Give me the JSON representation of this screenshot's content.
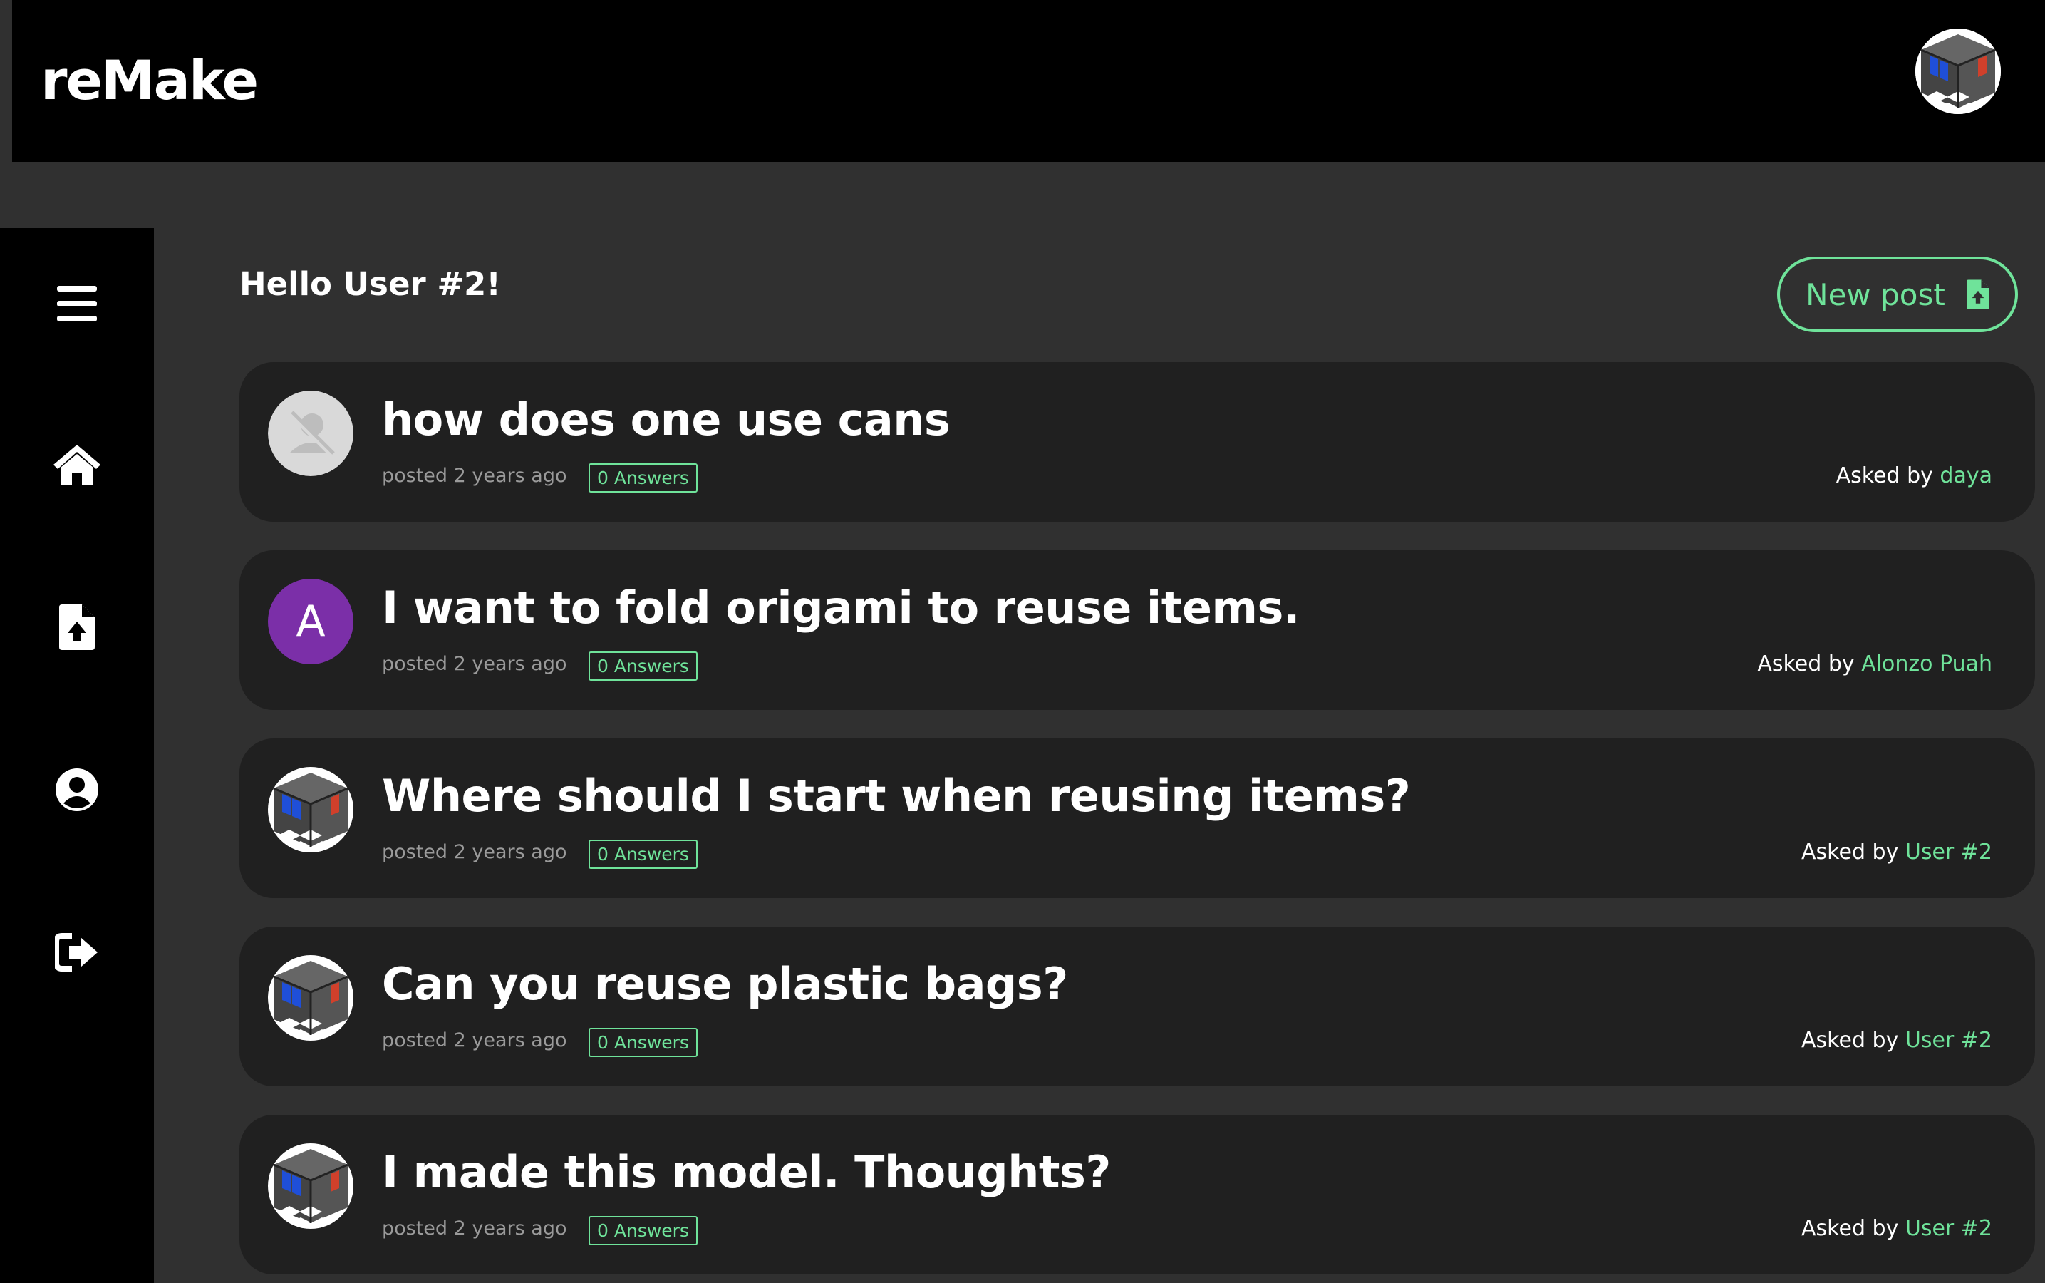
{
  "app": {
    "logo": "reMake"
  },
  "header": {
    "avatar_icon": "rubiks-cube-avatar"
  },
  "sidebar": {
    "items": [
      {
        "name": "menu",
        "icon": "hamburger-menu-icon"
      },
      {
        "name": "home",
        "icon": "home-icon"
      },
      {
        "name": "new-post",
        "icon": "file-upload-icon"
      },
      {
        "name": "profile",
        "icon": "user-circle-icon"
      },
      {
        "name": "logout",
        "icon": "sign-out-icon"
      }
    ]
  },
  "main": {
    "greeting": "Hello User #2!",
    "new_post_label": "New post",
    "posts": [
      {
        "title": "how does one use cans",
        "posted": "posted 2 years ago",
        "answers": "0 Answers",
        "asked_prefix": "Asked by ",
        "author": "daya",
        "avatar": "default-user"
      },
      {
        "title": "I want to fold origami to reuse items.",
        "posted": "posted 2 years ago",
        "answers": "0 Answers",
        "asked_prefix": "Asked by ",
        "author": "Alonzo Puah",
        "avatar": "letter",
        "avatar_letter": "A"
      },
      {
        "title": "Where should I start when reusing items?",
        "posted": "posted 2 years ago",
        "answers": "0 Answers",
        "asked_prefix": "Asked by ",
        "author": "User #2",
        "avatar": "rubiks-cube"
      },
      {
        "title": "Can you reuse plastic bags?",
        "posted": "posted 2 years ago",
        "answers": "0 Answers",
        "asked_prefix": "Asked by ",
        "author": "User #2",
        "avatar": "rubiks-cube"
      },
      {
        "title": "I made this model. Thoughts?",
        "posted": "posted 2 years ago",
        "answers": "0 Answers",
        "asked_prefix": "Asked by ",
        "author": "User #2",
        "avatar": "rubiks-cube"
      }
    ]
  },
  "colors": {
    "accent": "#6fe39a",
    "background": "#303030",
    "card": "#202020",
    "bar": "#000000",
    "letter_avatar": "#7b2fa8"
  }
}
